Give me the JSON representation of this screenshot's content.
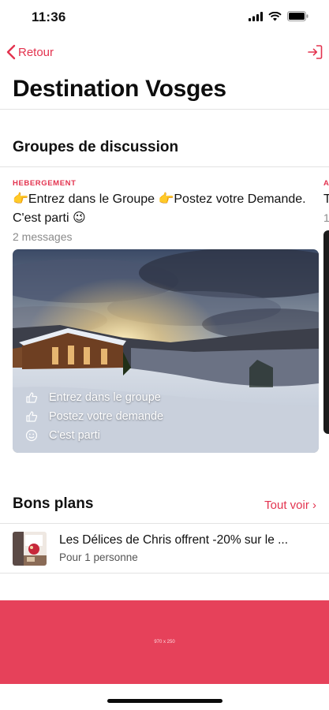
{
  "status_bar": {
    "time": "11:36"
  },
  "nav": {
    "back_label": "Retour"
  },
  "page": {
    "title": "Destination Vosges"
  },
  "groups": {
    "section_title": "Groupes de discussion",
    "cards": [
      {
        "category": "HEBERGEMENT",
        "title": "👉Entrez dans le Groupe 👉Postez votre Demande. C'est parti 😉",
        "meta": "2 messages",
        "overlay": [
          {
            "icon": "thumbs-up-icon",
            "label": "Entrez dans le groupe"
          },
          {
            "icon": "thumbs-up-icon",
            "label": "Postez votre demande"
          },
          {
            "icon": "smiley-icon",
            "label": "C'est parti"
          }
        ]
      },
      {
        "category": "A",
        "title": "T",
        "meta": "1"
      }
    ]
  },
  "deals": {
    "section_title": "Bons plans",
    "see_all": "Tout voir ›",
    "items": [
      {
        "title": "Les Délices de Chris offrent -20% sur le ...",
        "subtitle": "Pour 1 personne"
      }
    ]
  },
  "ad": {
    "label": "970 x 250"
  },
  "colors": {
    "accent": "#e3334f",
    "ad_background": "#e6415a"
  }
}
